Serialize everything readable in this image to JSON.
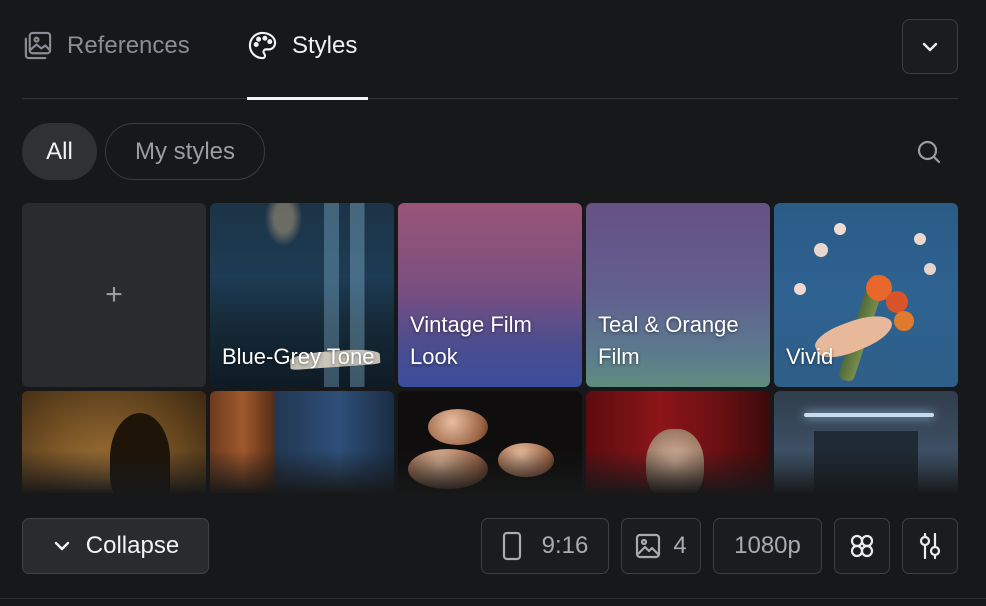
{
  "tabs": [
    {
      "label": "References",
      "icon": "image-gallery-icon",
      "active": false
    },
    {
      "label": "Styles",
      "icon": "palette-icon",
      "active": true
    }
  ],
  "header": {
    "dropdown_icon": "chevron-down-icon"
  },
  "filters": {
    "all_label": "All",
    "my_styles_label": "My styles",
    "active": "All",
    "search_icon": "search-icon"
  },
  "styles": {
    "add_label": "+",
    "cards": [
      {
        "title": "Blue-Grey Tone"
      },
      {
        "title": "Vintage Film Look"
      },
      {
        "title": "Teal & Orange Film"
      },
      {
        "title": "Vivid"
      }
    ]
  },
  "toolbar": {
    "collapse_label": "Collapse",
    "aspect_ratio": "9:16",
    "image_count": "4",
    "resolution": "1080p"
  },
  "colors": {
    "background": "#171819",
    "active_text": "#f2f2f4",
    "inactive_text": "#8a8d96",
    "border": "#3d3f44"
  }
}
